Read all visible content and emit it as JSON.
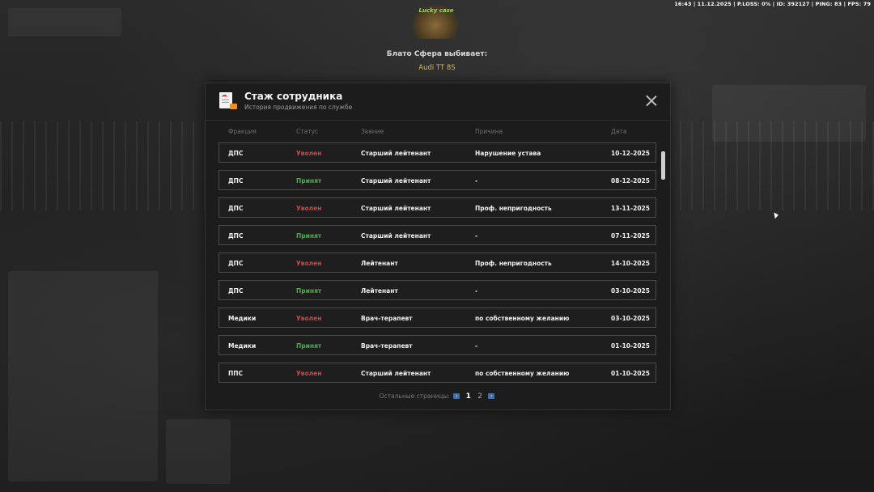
{
  "hud": "16:43 | 11.12.2025 | P.LOSS: 0% | ID: 392127 | PING: 83 | FPS: 79",
  "case": {
    "logo_text": "Lucky case",
    "drop_title": "Блато Сфера выбивает:",
    "drop_item": "Audi TT 8S"
  },
  "modal": {
    "title": "Стаж сотрудника",
    "subtitle": "История продвижения по службе",
    "columns": [
      "Фракция",
      "Статус",
      "Звание",
      "Причина",
      "Дата"
    ],
    "rows": [
      {
        "faction": "ДПС",
        "status": "Уволен",
        "rank": "Старший лейтенант",
        "reason": "Нарушение устава",
        "date": "10-12-2025"
      },
      {
        "faction": "ДПС",
        "status": "Принят",
        "rank": "Старший лейтенант",
        "reason": "-",
        "date": "08-12-2025"
      },
      {
        "faction": "ДПС",
        "status": "Уволен",
        "rank": "Старший лейтенант",
        "reason": "Проф. непригодность",
        "date": "13-11-2025"
      },
      {
        "faction": "ДПС",
        "status": "Принят",
        "rank": "Старший лейтенант",
        "reason": "-",
        "date": "07-11-2025"
      },
      {
        "faction": "ДПС",
        "status": "Уволен",
        "rank": "Лейтенант",
        "reason": "Проф. непригодность",
        "date": "14-10-2025"
      },
      {
        "faction": "ДПС",
        "status": "Принят",
        "rank": "Лейтенант",
        "reason": "-",
        "date": "03-10-2025"
      },
      {
        "faction": "Медики",
        "status": "Уволен",
        "rank": "Врач-терапевт",
        "reason": "по собственному желанию",
        "date": "03-10-2025"
      },
      {
        "faction": "Медики",
        "status": "Принят",
        "rank": "Врач-терапевт",
        "reason": "-",
        "date": "01-10-2025"
      },
      {
        "faction": "ППС",
        "status": "Уволен",
        "rank": "Старший лейтенант",
        "reason": "по собственному желанию",
        "date": "01-10-2025"
      }
    ],
    "status_colors": {
      "Уволен": "#d24545",
      "Принят": "#4cae4c"
    },
    "pager": {
      "label": "Остальные страницы:",
      "prev": "‹",
      "next": "›",
      "pages": [
        "1",
        "2"
      ],
      "current": "1"
    }
  }
}
